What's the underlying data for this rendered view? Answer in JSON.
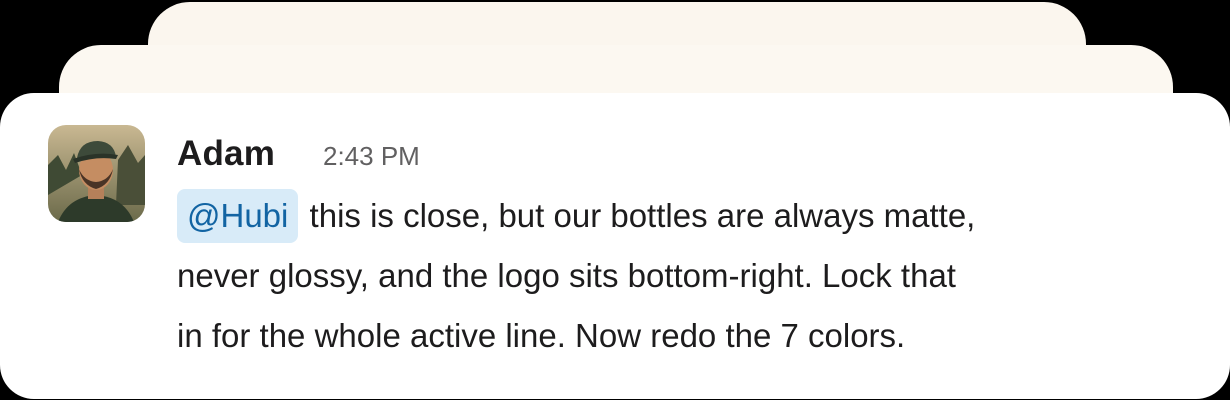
{
  "message": {
    "author": "Adam",
    "timestamp": "2:43 PM",
    "mention": "@Hubi",
    "line1": "this is close, but our bottles are always matte,",
    "line2": "never glossy, and the logo sits bottom-right. Lock that",
    "line3": "in for the whole active line. Now redo the 7 colors."
  },
  "colors": {
    "background": "#000000",
    "card": "#ffffff",
    "stacked_cards": "#fbf6ee",
    "mention_bg": "#d8ebf8",
    "mention_text": "#1264a3"
  },
  "icons": {
    "avatar": "user-photo-avatar"
  }
}
